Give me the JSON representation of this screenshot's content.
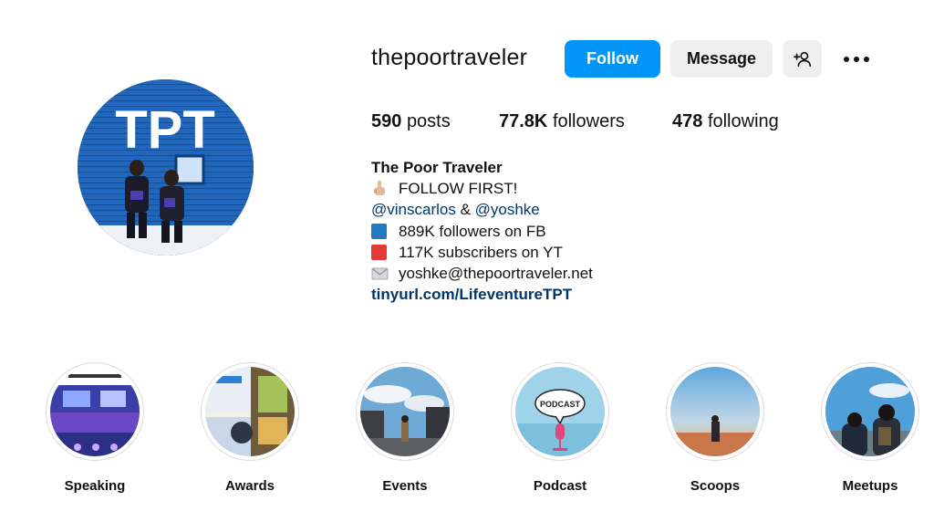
{
  "profile": {
    "username": "thepoortraveler",
    "avatar_text": "TPT",
    "buttons": {
      "follow": "Follow",
      "message": "Message",
      "suggest_icon": "add-person-icon",
      "more_icon": "more-options-icon"
    },
    "stats": {
      "posts_count": "590",
      "posts_label": "posts",
      "followers_count": "77.8K",
      "followers_label": "followers",
      "following_count": "478",
      "following_label": "following"
    },
    "bio": {
      "name": "The Poor Traveler",
      "line1_icon": "pointing-up-emoji",
      "line1": "FOLLOW FIRST!",
      "mention1": "@vinscarlos",
      "amp": " & ",
      "mention2": "@yoshke",
      "line3_icon": "blue-square-emoji",
      "line3": "889K followers on FB",
      "line4_icon": "red-square-emoji",
      "line4": "117K subscribers on YT",
      "line5_icon": "envelope-emoji",
      "line5": "yoshke@thepoortraveler.net",
      "link": "tinyurl.com/LifeventureTPT"
    }
  },
  "highlights": [
    {
      "label": "Speaking"
    },
    {
      "label": "Awards"
    },
    {
      "label": "Events"
    },
    {
      "label": "Podcast",
      "badge": "PODCAST"
    },
    {
      "label": "Scoops"
    },
    {
      "label": "Meetups"
    }
  ],
  "colors": {
    "follow_button": "#0095f6",
    "secondary_button": "#efefef",
    "link": "#00376b"
  }
}
